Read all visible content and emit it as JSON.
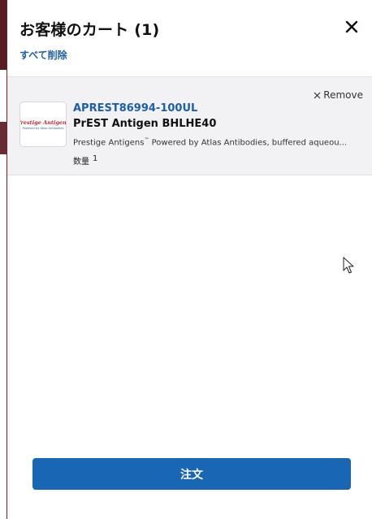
{
  "cart": {
    "title": "お客様のカート (1)",
    "clear_all_label": "すべて削除"
  },
  "item": {
    "remove_label": "Remove",
    "sku": "APREST86994-100UL",
    "name": "PrEST Antigen BHLHE40",
    "desc_brand": "Prestige Antigens",
    "desc_tm": "™",
    "desc_rest": " Powered by Atlas Antibodies, buffered aqueou...",
    "qty_label": "数量",
    "qty_value": "1",
    "logo_text": "Prestige Antigens",
    "logo_subtext": "Powered by Atlas Antibodies"
  },
  "footer": {
    "order_label": "注文"
  },
  "icons": {
    "close": "close-icon",
    "remove": "x-icon",
    "cursor": "mouse-pointer-icon"
  },
  "colors": {
    "link_blue": "#1d5ea8",
    "button_blue": "#1866b4",
    "panel_bg": "#f2f2f4"
  }
}
